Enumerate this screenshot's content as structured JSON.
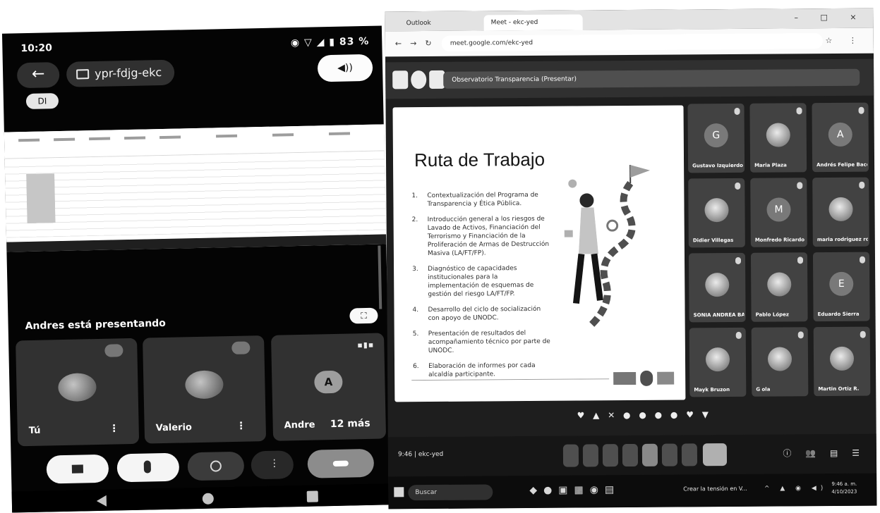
{
  "phone": {
    "time": "10:20",
    "status_icons": "◉ ▽ ◢ ▮ 83 %",
    "meeting_code": "ypr-fdjg-ekc",
    "badge": "DI",
    "presenting_text": "Andres está presentando",
    "tiles": [
      {
        "name": "Tú"
      },
      {
        "name": "Valerio"
      },
      {
        "name": "Andre",
        "letter": "A",
        "more": "12 más"
      }
    ]
  },
  "browser": {
    "tab1": "Outlook",
    "tab2": "Meet - ekc-yed",
    "url": "meet.google.com/ekc-yed",
    "meet_title": "Observatorio Transparencia (Presentar)",
    "window_controls": "– □ ×"
  },
  "slide": {
    "title": "Ruta de Trabajo",
    "items": [
      {
        "n": "1.",
        "text": "Contextualización del Programa de Transparencia y Ética Pública."
      },
      {
        "n": "2.",
        "text": "Introducción general a los riesgos de Lavado de Activos, Financiación del Terrorismo y Financiación de la Proliferación de Armas de Destrucción Masiva (LA/FT/FP)."
      },
      {
        "n": "3.",
        "text": "Diagnóstico de capacidades institucionales para la implementación de esquemas de gestión del riesgo LA/FT/FP."
      },
      {
        "n": "4.",
        "text": "Desarrollo del ciclo de socialización con apoyo de UNODC."
      },
      {
        "n": "5.",
        "text": "Presentación de resultados del acompañamiento técnico por parte de UNODC."
      },
      {
        "n": "6.",
        "text": "Elaboración de informes por cada alcaldía participante."
      }
    ]
  },
  "participants": [
    {
      "name": "Gustavo Izquierdo",
      "letter": "G",
      "photo": false,
      "active": true
    },
    {
      "name": "Maria Plaza",
      "letter": "",
      "photo": true,
      "active": false
    },
    {
      "name": "Andrés Felipe Bacena R.",
      "letter": "A",
      "photo": false,
      "active": false
    },
    {
      "name": "Didier Villegas",
      "letter": "",
      "photo": true,
      "active": false
    },
    {
      "name": "Monfredo Ricardo",
      "letter": "M",
      "photo": false,
      "active": false
    },
    {
      "name": "maria rodriguez rosales",
      "letter": "",
      "photo": true,
      "active": false
    },
    {
      "name": "SONIA ANDREA BASCO...",
      "letter": "",
      "photo": true,
      "active": false
    },
    {
      "name": "Pablo López",
      "letter": "",
      "photo": true,
      "active": false
    },
    {
      "name": "Eduardo Sierra",
      "letter": "E",
      "photo": false,
      "active": false
    },
    {
      "name": "Mayk Bruzon",
      "letter": "",
      "photo": true,
      "active": false
    },
    {
      "name": "G ola",
      "letter": "",
      "photo": true,
      "active": false
    },
    {
      "name": "Martin Ortiz R.",
      "letter": "",
      "photo": true,
      "active": false
    }
  ],
  "meet_bottom": {
    "time_code": "9:46 | ekc-yed",
    "reactions": "♥ ▲ ✕ ● ● ● ● ♥ ▼",
    "right_icons": "ⓘ 👥 ▤ ☰"
  },
  "taskbar": {
    "search_placeholder": "Buscar",
    "notification": "Crear la tensión en V...",
    "clock_time": "9:46 a. m.",
    "clock_date": "4/10/2023"
  }
}
